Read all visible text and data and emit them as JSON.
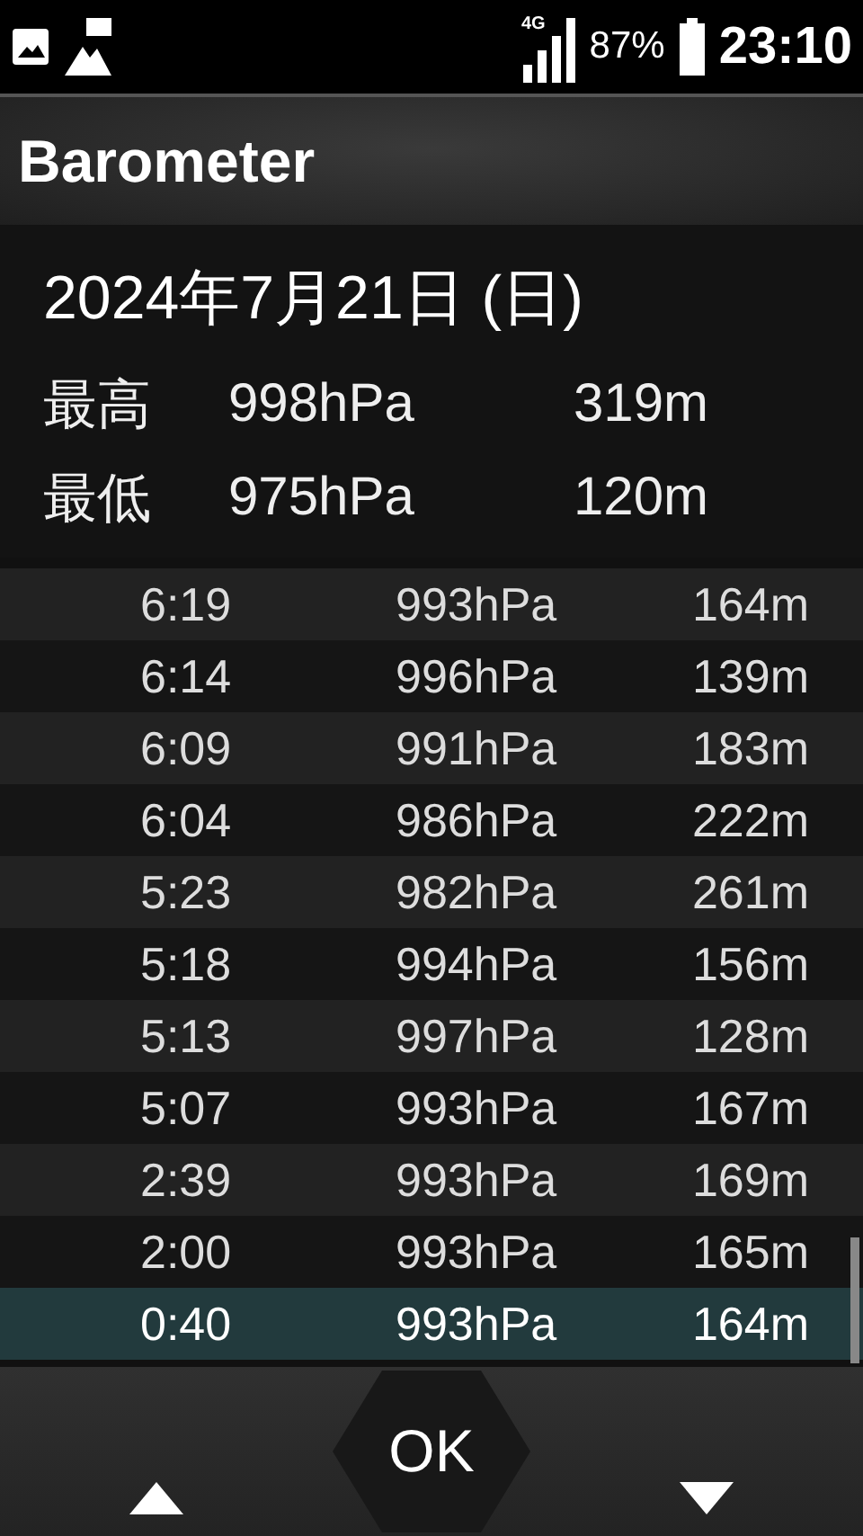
{
  "status_bar": {
    "network": "4G",
    "battery": "87%",
    "time": "23:10"
  },
  "title": "Barometer",
  "summary": {
    "date": "2024年7月21日 (日)",
    "rows": [
      {
        "label": "最高",
        "pressure": "998hPa",
        "altitude": "319m"
      },
      {
        "label": "最低",
        "pressure": "975hPa",
        "altitude": "120m"
      }
    ]
  },
  "readings": [
    {
      "time": "6:19",
      "pressure": "993hPa",
      "altitude": "164m",
      "selected": false
    },
    {
      "time": "6:14",
      "pressure": "996hPa",
      "altitude": "139m",
      "selected": false
    },
    {
      "time": "6:09",
      "pressure": "991hPa",
      "altitude": "183m",
      "selected": false
    },
    {
      "time": "6:04",
      "pressure": "986hPa",
      "altitude": "222m",
      "selected": false
    },
    {
      "time": "5:23",
      "pressure": "982hPa",
      "altitude": "261m",
      "selected": false
    },
    {
      "time": "5:18",
      "pressure": "994hPa",
      "altitude": "156m",
      "selected": false
    },
    {
      "time": "5:13",
      "pressure": "997hPa",
      "altitude": "128m",
      "selected": false
    },
    {
      "time": "5:07",
      "pressure": "993hPa",
      "altitude": "167m",
      "selected": false
    },
    {
      "time": "2:39",
      "pressure": "993hPa",
      "altitude": "169m",
      "selected": false
    },
    {
      "time": "2:00",
      "pressure": "993hPa",
      "altitude": "165m",
      "selected": false
    },
    {
      "time": "0:40",
      "pressure": "993hPa",
      "altitude": "164m",
      "selected": true
    }
  ],
  "softkeys": {
    "ok": "OK"
  }
}
